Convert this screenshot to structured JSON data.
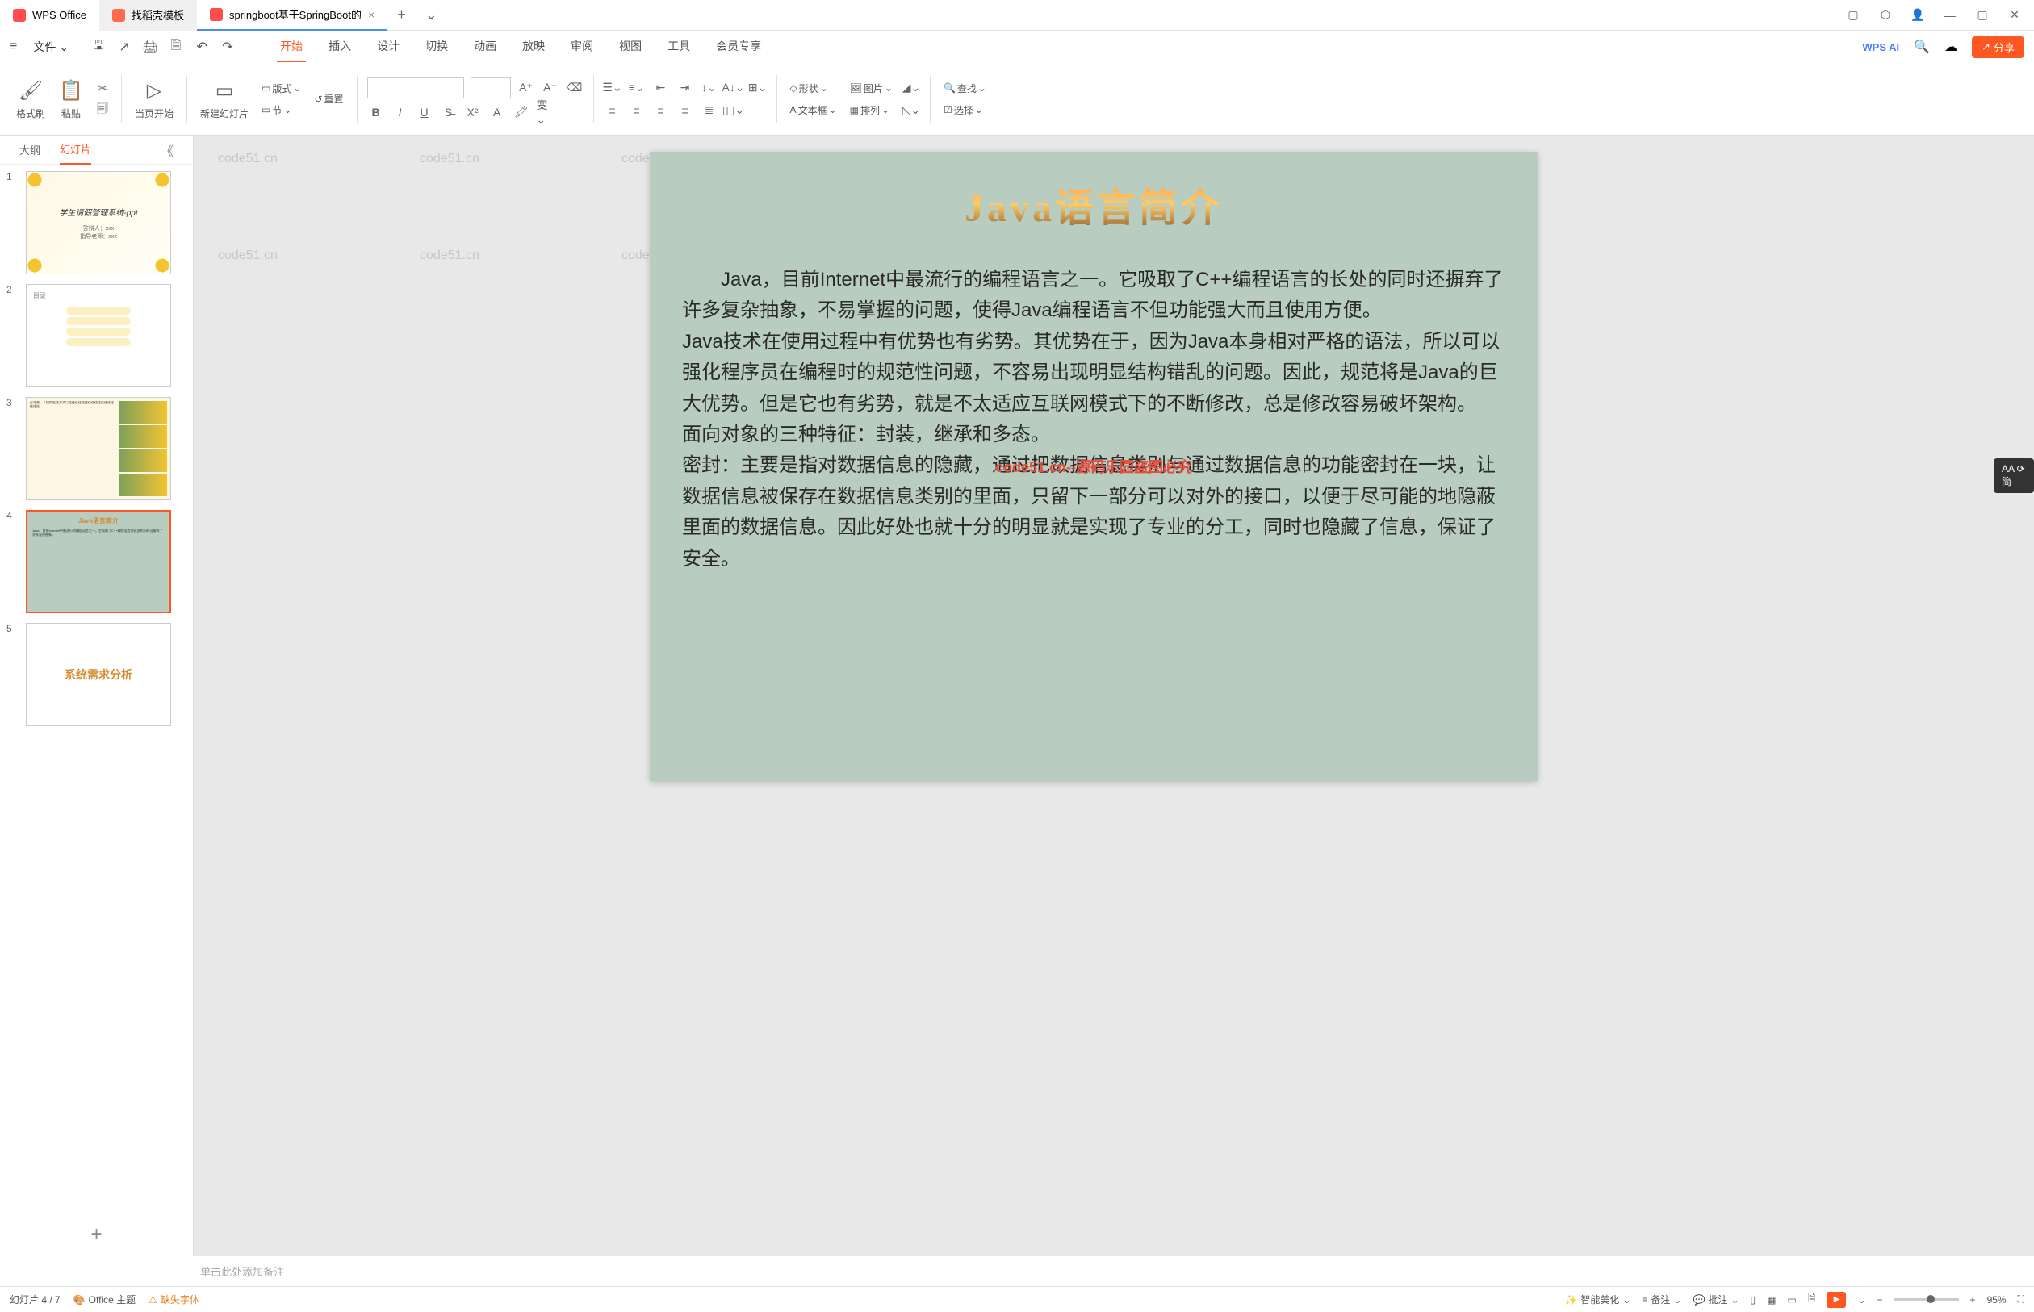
{
  "titlebar": {
    "app_name": "WPS Office",
    "tab2": "找稻壳模板",
    "tab3": "springboot基于SpringBoot的",
    "add": "+"
  },
  "menubar": {
    "file": "文件",
    "tabs": [
      "开始",
      "插入",
      "设计",
      "切换",
      "动画",
      "放映",
      "审阅",
      "视图",
      "工具",
      "会员专享"
    ],
    "wps_ai": "WPS AI",
    "share": "分享"
  },
  "ribbon": {
    "format_painter": "格式刷",
    "paste": "粘贴",
    "from_current": "当页开始",
    "new_slide": "新建幻灯片",
    "layout": "版式",
    "section": "节",
    "reset": "重置",
    "shape": "形状",
    "picture": "图片",
    "textbox": "文本框",
    "arrange": "排列",
    "find": "查找",
    "select": "选择"
  },
  "panel": {
    "outline": "大纲",
    "slides": "幻灯片"
  },
  "thumbs": {
    "t1_title": "学生请假管理系统-ppt",
    "t1_line1": "答辩人：xxx",
    "t1_line2": "指导老师：xxx",
    "t2_title": "目录",
    "t4_title": "Java语言简介",
    "t5_title": "系统需求分析"
  },
  "slide": {
    "title": "Java语言简介",
    "p1": "Java，目前Internet中最流行的编程语言之一。它吸取了C++编程语言的长处的同时还摒弃了许多复杂抽象，不易掌握的问题，使得Java编程语言不但功能强大而且使用方便。",
    "p2": "Java技术在使用过程中有优势也有劣势。其优势在于，因为Java本身相对严格的语法，所以可以强化程序员在编程时的规范性问题，不容易出现明显结构错乱的问题。因此，规范将是Java的巨大优势。但是它也有劣势，就是不太适应互联网模式下的不断修改，总是修改容易破坏架构。",
    "p3": "面向对象的三种特征：封装，继承和多态。",
    "p4": "密封：主要是指对数据信息的隐藏，通过把数据信息类别与通过数据信息的功能密封在一块，让数据信息被保存在数据信息类别的里面，只留下一部分可以对外的接口，以便于尽可能的地隐蔽里面的数据信息。因此好处也就十分的明显就是实现了专业的分工，同时也隐藏了信息，保证了安全。"
  },
  "watermark": "code51.cn",
  "watermark_red": "code51.cn--源码乐园盗图必究",
  "notes": {
    "placeholder": "单击此处添加备注"
  },
  "statusbar": {
    "slide_count": "幻灯片 4 / 7",
    "theme": "Office 主题",
    "missing_font": "缺失字体",
    "beautify": "智能美化",
    "notes": "备注",
    "comments": "批注",
    "zoom": "95%"
  }
}
